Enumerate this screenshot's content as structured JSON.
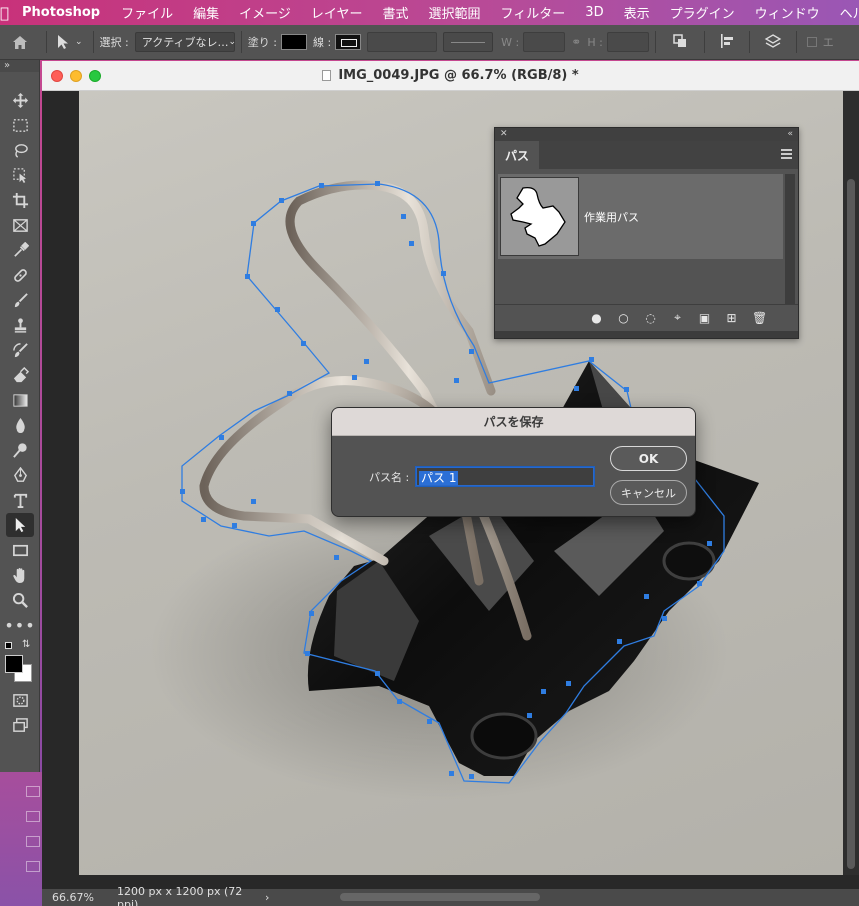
{
  "menubar": {
    "app_name": "Photoshop",
    "items": [
      "ファイル",
      "編集",
      "イメージ",
      "レイヤー",
      "書式",
      "選択範囲",
      "フィルター",
      "3D",
      "表示",
      "プラグイン",
      "ウィンドウ",
      "ヘル"
    ]
  },
  "options_bar": {
    "select_label": "選択 :",
    "select_value": "アクティブなレ…",
    "fill_label": "塗り :",
    "stroke_label": "線 :",
    "w_label": "W :",
    "h_label": "H :",
    "edge_label": "エ"
  },
  "document": {
    "title": "IMG_0049.JPG @ 66.7% (RGB/8) *",
    "zoom": "66.67%",
    "info": "1200 px x 1200 px (72 ppi)"
  },
  "paths_panel": {
    "tab_label": "パス",
    "path_name": "作業用パス"
  },
  "dialog": {
    "title": "パスを保存",
    "name_label": "パス名 :",
    "name_value": "パス 1",
    "ok_label": "OK",
    "cancel_label": "キャンセル"
  },
  "colors": {
    "accent": "#2b6fd6",
    "path_anchor": "#2f7de1"
  }
}
